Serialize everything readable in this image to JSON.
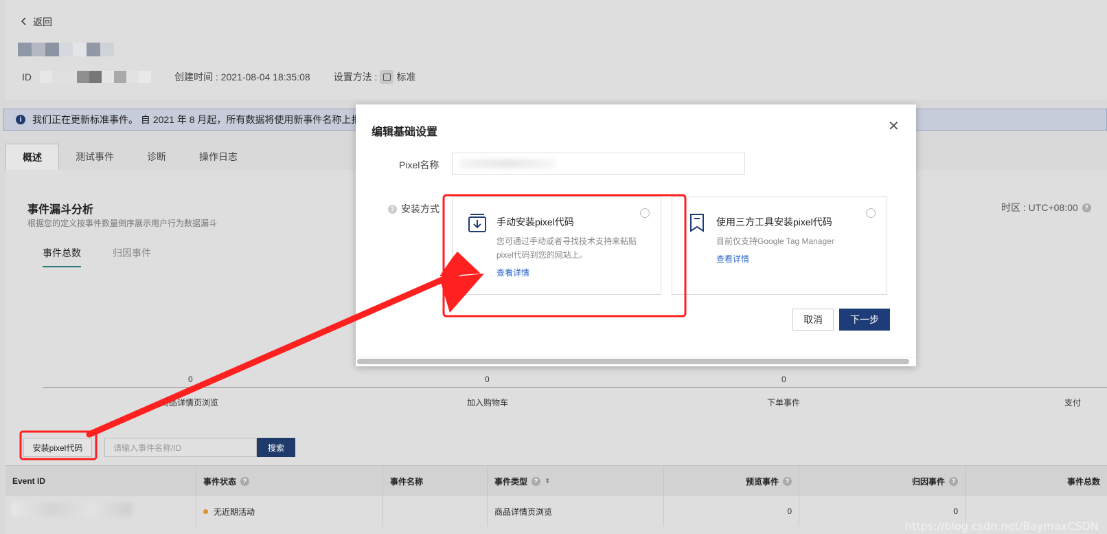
{
  "header": {
    "back_label": "返回",
    "id_label": "ID",
    "created_label": "创建时间 : 2021-08-04 18:35:08",
    "setup_label": "设置方法 :",
    "setup_value": "标准"
  },
  "banner": {
    "text": "我们正在更新标准事件。 自 2021 年 8 月起，所有数据将使用新事件名称上报。"
  },
  "tabs": [
    {
      "label": "概述",
      "active": true
    },
    {
      "label": "测试事件",
      "active": false
    },
    {
      "label": "诊断",
      "active": false
    },
    {
      "label": "操作日志",
      "active": false
    }
  ],
  "funnel": {
    "title": "事件漏斗分析",
    "subtitle": "根据您的定义按事件数量倒序展示用户行为数据漏斗",
    "timezone": "时区 : UTC+08:00",
    "subtabs": [
      "事件总数",
      "归因事件"
    ],
    "values": [
      "0",
      "0",
      "0"
    ],
    "categories": [
      "商品详情页浏览",
      "加入购物车",
      "下单事件",
      "支付"
    ]
  },
  "toolbar": {
    "install_label": "安装pixel代码",
    "search_placeholder": "请输入事件名称/ID",
    "search_label": "搜索"
  },
  "table": {
    "headers": [
      "Event ID",
      "事件状态",
      "事件名称",
      "事件类型",
      "预览事件",
      "归因事件",
      "事件总数"
    ],
    "row": {
      "status": "无近期活动",
      "name": "",
      "type": "商品详情页浏览",
      "preview": "0",
      "attributed": "0"
    }
  },
  "modal": {
    "title": "编辑基础设置",
    "pixel_name_label": "Pixel名称",
    "install_method_label": "安装方式",
    "options": [
      {
        "title": "手动安装pixel代码",
        "desc": "您可通过手动或者寻找技术支持来粘贴pixel代码到您的网站上。",
        "link": "查看详情",
        "icon": "download-box-icon"
      },
      {
        "title": "使用三方工具安装pixel代码",
        "desc": "目前仅支持Google Tag Manager",
        "link": "查看详情",
        "icon": "bookmark-icon"
      }
    ],
    "cancel_label": "取消",
    "next_label": "下一步"
  },
  "watermark": "https://blog.csdn.net/BaymaxCSDN",
  "colors": {
    "primary": "#1e3c78",
    "annotation_red": "#ff2020",
    "link": "#2a64c8"
  }
}
